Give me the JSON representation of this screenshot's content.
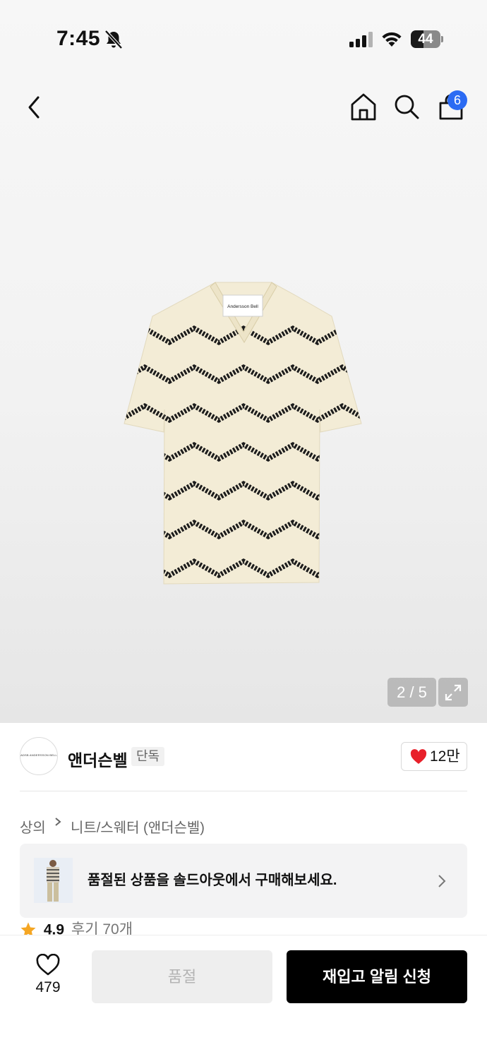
{
  "status_bar": {
    "time": "7:45",
    "battery": "44",
    "battery_level_percent": 44
  },
  "nav": {
    "bag_count": "6",
    "icons": [
      "back-icon",
      "home-icon",
      "search-icon",
      "shopping-bag-icon"
    ]
  },
  "gallery": {
    "counter": "2 / 5",
    "product_label_text": "Andersson Bell",
    "colors": {
      "shirt": "#f3ecd6",
      "zigzag": "#1c1c1c"
    }
  },
  "brand": {
    "name": "앤더슨벨",
    "tag": "단독",
    "logo_text": "ADSB ANDERSSON BELL",
    "likes": "12만",
    "like_color": "#e8202a"
  },
  "breadcrumb": {
    "category": "상의",
    "subcategory": "니트/스웨터 (앤더슨벨)"
  },
  "banner": {
    "text": "품절된 상품을 솔드아웃에서 구매해보세요."
  },
  "rating": {
    "score": "4.9",
    "reviews": "후기 70개",
    "star_color": "#f5a623"
  },
  "bottom_bar": {
    "wish_count": "479",
    "soldout_label": "품절",
    "restock_label": "재입고 알림 신청"
  }
}
